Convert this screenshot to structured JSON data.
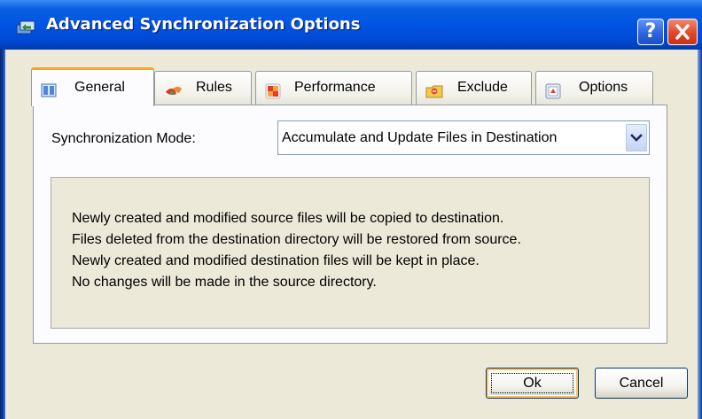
{
  "window": {
    "title": "Advanced Synchronization Options",
    "help_label": "?",
    "close_label": "×"
  },
  "tabs": [
    {
      "label": "General",
      "icon": "general-icon",
      "selected": true
    },
    {
      "label": "Rules",
      "icon": "rules-icon",
      "selected": false
    },
    {
      "label": "Performance",
      "icon": "performance-icon",
      "selected": false
    },
    {
      "label": "Exclude",
      "icon": "exclude-icon",
      "selected": false
    },
    {
      "label": "Options",
      "icon": "options-icon",
      "selected": false
    }
  ],
  "general": {
    "mode_label": "Synchronization Mode:",
    "mode_value": "Accumulate and Update Files in Destination",
    "description": [
      "Newly created and modified source files will be copied to destination.",
      "Files deleted from the destination directory will be restored from source.",
      "Newly created and modified destination files will be kept in place.",
      "No changes will be made in the source directory."
    ]
  },
  "buttons": {
    "ok_label": "Ok",
    "cancel_label": "Cancel"
  },
  "colors": {
    "titlebar": "#0054e3",
    "dialog_bg": "#ece9d8",
    "tab_highlight": "#f0a53a",
    "close_button": "#e0482a"
  }
}
